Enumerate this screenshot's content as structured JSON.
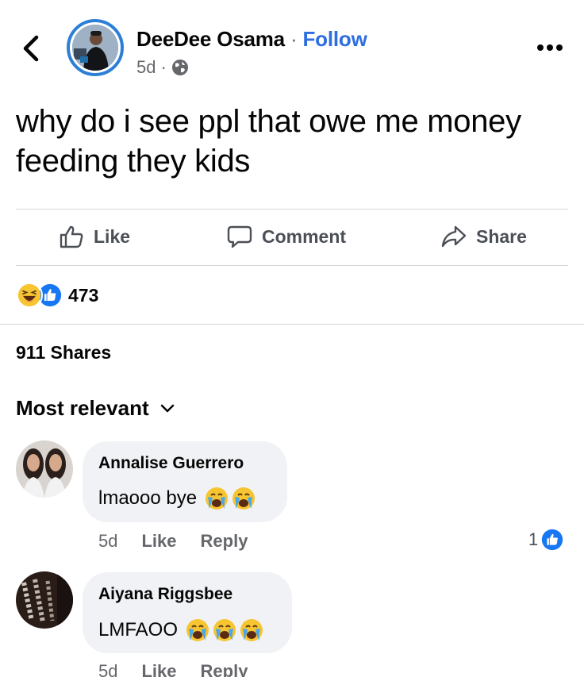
{
  "post": {
    "author": "DeeDee Osama",
    "separator": "·",
    "follow_label": "Follow",
    "time": "5d",
    "time_separator": "·",
    "privacy_icon": "globe-icon",
    "text": "why do i see ppl that owe me money feeding they kids"
  },
  "actions": {
    "like_label": "Like",
    "comment_label": "Comment",
    "share_label": "Share"
  },
  "stats": {
    "reaction_count": "473",
    "shares_label": "911 Shares"
  },
  "comments_section": {
    "sort_label": "Most relevant"
  },
  "comments": [
    {
      "name": "Annalise Guerrero",
      "text": "lmaooo bye",
      "emojis": [
        "crying-face",
        "crying-face"
      ],
      "time": "5d",
      "like_label": "Like",
      "reply_label": "Reply",
      "like_count": "1"
    },
    {
      "name": "Aiyana Riggsbee",
      "text": "LMFAOO",
      "emojis": [
        "crying-face",
        "crying-face",
        "crying-face"
      ],
      "time": "5d",
      "like_label": "Like",
      "reply_label": "Reply"
    }
  ],
  "colors": {
    "accent": "#2d6ee0",
    "avatar_ring": "#2d7fd6",
    "bubble": "#f0f2f5",
    "muted": "#65676b",
    "divider": "#d4d6da"
  }
}
